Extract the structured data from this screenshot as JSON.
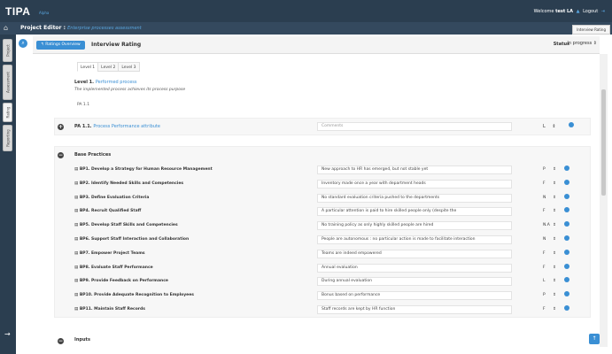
{
  "topbar": {
    "brand": "TIPA",
    "brand_sub": "Alpha",
    "welcome_prefix": "Welcome",
    "username": "test LA",
    "logout": "Logout"
  },
  "editor": {
    "title": "Project Editor :",
    "subtitle": "Enterprise processes assessment",
    "tooltip": "Interview Rating"
  },
  "lefttabs": [
    "Project",
    "Assessment",
    "Rating",
    "Reporting"
  ],
  "header": {
    "back_label": "Ratings Overview",
    "page_title": "Interview Rating",
    "status_label": "Status",
    "status_value": "In progress"
  },
  "level_tabs": [
    "Level 1",
    "Level 2",
    "Level 3"
  ],
  "level": {
    "title": "Level 1.",
    "title_name": "Performed process",
    "description": "The implemented process achieves its process purpose",
    "pa_chip": "PA 1.1"
  },
  "pa": {
    "title": "PA 1.1.",
    "title_name": "Process Performance attribute",
    "comment_placeholder": "Comments",
    "rating": "L"
  },
  "bp_section": "Base Practices",
  "base_practices": [
    {
      "name": "BP1. Develop a Strategy for Human Resource Management",
      "comment": "New approach to HR has emerged, but not stable yet",
      "rating": "P"
    },
    {
      "name": "BP2. Identify Needed Skills and Competencies",
      "comment": "Inventory made once a year with department heads",
      "rating": "F"
    },
    {
      "name": "BP3. Define Evaluation Criteria",
      "comment": "No standard evaluation criteria pushed to the departments",
      "rating": "N"
    },
    {
      "name": "BP4. Recruit Qualified Staff",
      "comment": "A particular attention is paid to hire skilled people only (despite the",
      "rating": "F"
    },
    {
      "name": "BP5. Develop Staff Skills and Competencies",
      "comment": "No training policy as only highly skilled people are hired",
      "rating": "N.A"
    },
    {
      "name": "BP6. Support Staff Interaction and Collaboration",
      "comment": "People are autonomous : no particular action is made to facilitate interaction",
      "rating": "N"
    },
    {
      "name": "BP7. Empower Project Teams",
      "comment": "Teams are indeed empowered",
      "rating": "F"
    },
    {
      "name": "BP8. Evaluate Staff Performance",
      "comment": "Annual evaluation",
      "rating": "F"
    },
    {
      "name": "BP9. Provide Feedback on Performance",
      "comment": "During annual evaluation",
      "rating": "L"
    },
    {
      "name": "BP10. Provide Adequate Recognition to Employees",
      "comment": "Bonus based on performance",
      "rating": "P"
    },
    {
      "name": "BP11. Maintain Staff Records",
      "comment": "Staff records are kept by HR function",
      "rating": "F"
    }
  ],
  "inputs_section": "Inputs"
}
